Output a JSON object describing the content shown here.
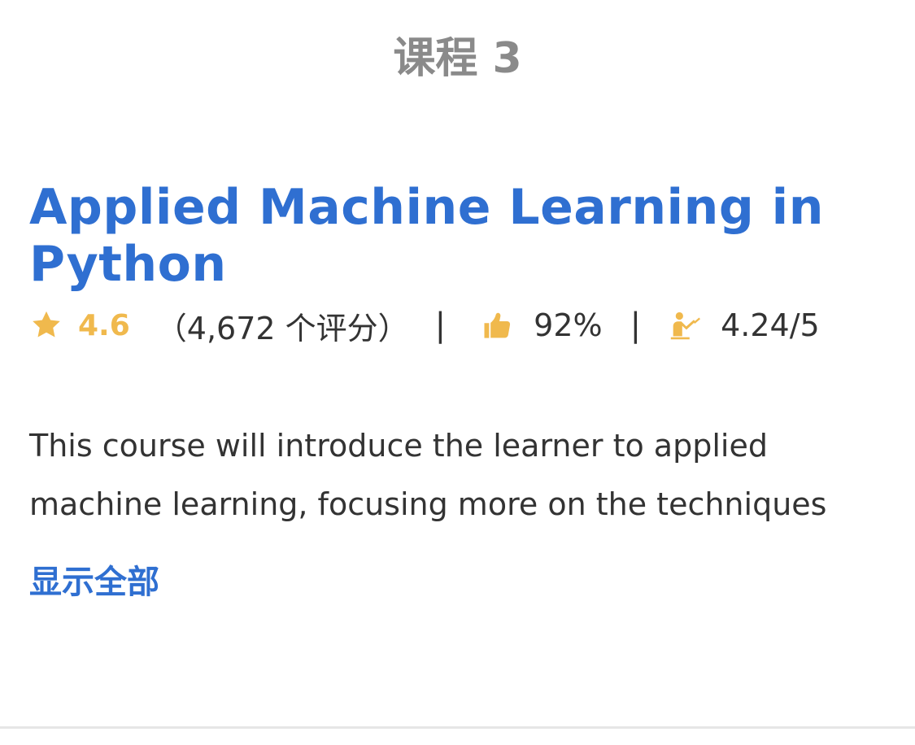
{
  "section": {
    "heading": "课程 3"
  },
  "course": {
    "title": "Applied Machine Learning in Python",
    "rating": {
      "icon": "star-icon",
      "value": "4.6",
      "count_text": "（4,672 个评分）",
      "color": "#f0b94d"
    },
    "divider": "|",
    "approval": {
      "icon": "thumbs-up-icon",
      "value": "92%"
    },
    "teacher_score": {
      "icon": "instructor-icon",
      "value": "4.24/5"
    },
    "description": "This course will introduce the learner to applied machine learning, focusing more on the techniques",
    "show_all_label": "显示全部",
    "title_color": "#2f6fd1"
  }
}
